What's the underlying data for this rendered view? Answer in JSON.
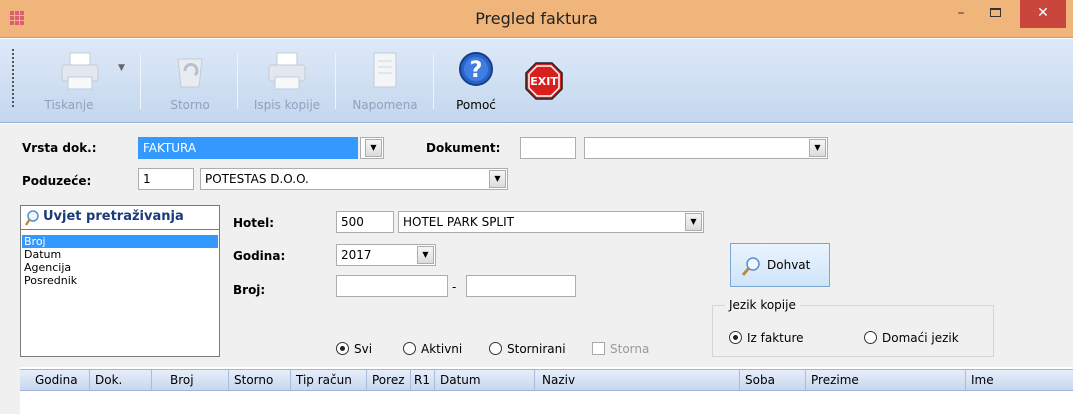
{
  "window": {
    "title": "Pregled faktura",
    "minimize": "–",
    "close": "✕"
  },
  "toolbar": {
    "items": [
      {
        "label": "Tiskanje",
        "icon": "printer-icon",
        "enabled": false
      },
      {
        "label": "Storno",
        "icon": "recycle-bin-icon",
        "enabled": false
      },
      {
        "label": "Ispis kopije",
        "icon": "printer-copy-icon",
        "enabled": false
      },
      {
        "label": "Napomena",
        "icon": "note-icon",
        "enabled": false
      },
      {
        "label": "Pomoć",
        "icon": "help-icon",
        "enabled": true
      },
      {
        "label": "",
        "icon": "exit-icon",
        "enabled": true
      }
    ],
    "exit_text": "EXIT"
  },
  "form": {
    "vrsta_label": "Vrsta dok.:",
    "vrsta_value": "FAKTURA",
    "dokument_label": "Dokument:",
    "dokument_code": "",
    "dokument_value": "",
    "poduzece_label": "Poduzeće:",
    "poduzece_code": "1",
    "poduzece_value": "POTESTAS D.O.O."
  },
  "search": {
    "title": "Uvjet pretraživanja",
    "items": [
      "Broj",
      "Datum",
      "Agencija",
      "Posrednik"
    ],
    "selected_index": 0
  },
  "filters": {
    "hotel_label": "Hotel:",
    "hotel_code": "500",
    "hotel_value": "HOTEL PARK SPLIT",
    "godina_label": "Godina:",
    "godina_value": "2017",
    "broj_label": "Broj:",
    "broj_from": "",
    "broj_separator": "-",
    "broj_to": ""
  },
  "status_radios": {
    "options": [
      {
        "label": "Svi",
        "checked": true
      },
      {
        "label": "Aktivni",
        "checked": false
      },
      {
        "label": "Stornirani",
        "checked": false
      }
    ],
    "storna_label": "Storna",
    "storna_checked": false
  },
  "dohvat_label": "Dohvat",
  "jezik": {
    "title": "Jezik kopije",
    "options": [
      {
        "label": "Iz fakture",
        "checked": true
      },
      {
        "label": "Domaći jezik",
        "checked": false
      }
    ]
  },
  "grid": {
    "columns": [
      "Godina",
      "Dok.",
      "Broj",
      "Storno",
      "Tip račun",
      "Porez",
      "R1",
      "Datum",
      "Naziv",
      "Soba",
      "Prezime",
      "Ime"
    ]
  },
  "colors": {
    "titlebar": "#f0b57a",
    "close_button": "#c9463d",
    "selection": "#3399ff"
  }
}
